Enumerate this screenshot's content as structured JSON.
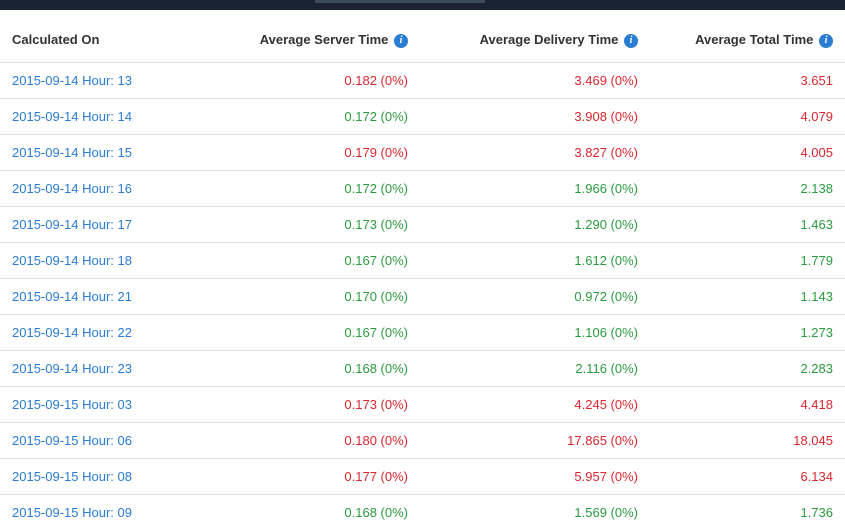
{
  "headers": {
    "calculated_on": "Calculated On",
    "avg_server_time": "Average Server Time",
    "avg_delivery_time": "Average Delivery Time",
    "avg_total_time": "Average Total Time"
  },
  "rows": [
    {
      "label": "2015-09-14 Hour: 13",
      "server": {
        "text": "0.182 (0%)",
        "cls": "red"
      },
      "delivery": {
        "text": "3.469 (0%)",
        "cls": "red"
      },
      "total": {
        "text": "3.651",
        "cls": "red"
      }
    },
    {
      "label": "2015-09-14 Hour: 14",
      "server": {
        "text": "0.172 (0%)",
        "cls": "green"
      },
      "delivery": {
        "text": "3.908 (0%)",
        "cls": "red"
      },
      "total": {
        "text": "4.079",
        "cls": "red"
      }
    },
    {
      "label": "2015-09-14 Hour: 15",
      "server": {
        "text": "0.179 (0%)",
        "cls": "red"
      },
      "delivery": {
        "text": "3.827 (0%)",
        "cls": "red"
      },
      "total": {
        "text": "4.005",
        "cls": "red"
      }
    },
    {
      "label": "2015-09-14 Hour: 16",
      "server": {
        "text": "0.172 (0%)",
        "cls": "green"
      },
      "delivery": {
        "text": "1.966 (0%)",
        "cls": "green"
      },
      "total": {
        "text": "2.138",
        "cls": "green"
      }
    },
    {
      "label": "2015-09-14 Hour: 17",
      "server": {
        "text": "0.173 (0%)",
        "cls": "green"
      },
      "delivery": {
        "text": "1.290 (0%)",
        "cls": "green"
      },
      "total": {
        "text": "1.463",
        "cls": "green"
      }
    },
    {
      "label": "2015-09-14 Hour: 18",
      "server": {
        "text": "0.167 (0%)",
        "cls": "green"
      },
      "delivery": {
        "text": "1.612 (0%)",
        "cls": "green"
      },
      "total": {
        "text": "1.779",
        "cls": "green"
      }
    },
    {
      "label": "2015-09-14 Hour: 21",
      "server": {
        "text": "0.170 (0%)",
        "cls": "green"
      },
      "delivery": {
        "text": "0.972 (0%)",
        "cls": "green"
      },
      "total": {
        "text": "1.143",
        "cls": "green"
      }
    },
    {
      "label": "2015-09-14 Hour: 22",
      "server": {
        "text": "0.167 (0%)",
        "cls": "green"
      },
      "delivery": {
        "text": "1.106 (0%)",
        "cls": "green"
      },
      "total": {
        "text": "1.273",
        "cls": "green"
      }
    },
    {
      "label": "2015-09-14 Hour: 23",
      "server": {
        "text": "0.168 (0%)",
        "cls": "green"
      },
      "delivery": {
        "text": "2.116 (0%)",
        "cls": "green"
      },
      "total": {
        "text": "2.283",
        "cls": "green"
      }
    },
    {
      "label": "2015-09-15 Hour: 03",
      "server": {
        "text": "0.173 (0%)",
        "cls": "red"
      },
      "delivery": {
        "text": "4.245 (0%)",
        "cls": "red"
      },
      "total": {
        "text": "4.418",
        "cls": "red"
      }
    },
    {
      "label": "2015-09-15 Hour: 06",
      "server": {
        "text": "0.180 (0%)",
        "cls": "red"
      },
      "delivery": {
        "text": "17.865 (0%)",
        "cls": "red"
      },
      "total": {
        "text": "18.045",
        "cls": "red"
      }
    },
    {
      "label": "2015-09-15 Hour: 08",
      "server": {
        "text": "0.177 (0%)",
        "cls": "red"
      },
      "delivery": {
        "text": "5.957 (0%)",
        "cls": "red"
      },
      "total": {
        "text": "6.134",
        "cls": "red"
      }
    },
    {
      "label": "2015-09-15 Hour: 09",
      "server": {
        "text": "0.168 (0%)",
        "cls": "green"
      },
      "delivery": {
        "text": "1.569 (0%)",
        "cls": "green"
      },
      "total": {
        "text": "1.736",
        "cls": "green"
      }
    }
  ]
}
